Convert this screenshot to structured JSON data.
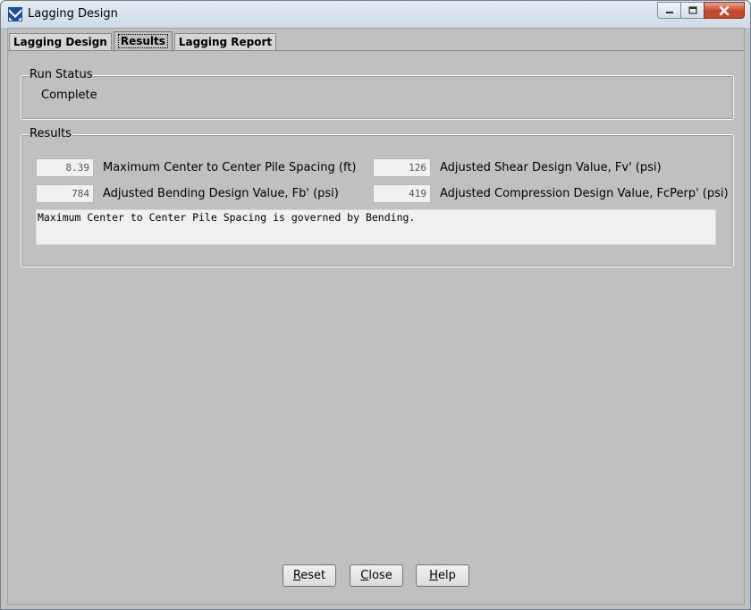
{
  "window": {
    "title": "Lagging Design"
  },
  "tabs": [
    {
      "label": "Lagging Design",
      "active": false
    },
    {
      "label": "Results",
      "active": true
    },
    {
      "label": "Lagging Report",
      "active": false
    }
  ],
  "run_status": {
    "legend": "Run Status",
    "value": "Complete"
  },
  "results": {
    "legend": "Results",
    "fields": [
      {
        "value": "8.39",
        "label": "Maximum Center to Center Pile Spacing (ft)"
      },
      {
        "value": "126",
        "label": "Adjusted Shear Design Value, Fv' (psi)"
      },
      {
        "value": "784",
        "label": "Adjusted Bending Design Value, Fb' (psi)"
      },
      {
        "value": "419",
        "label": "Adjusted Compression Design Value, FcPerp' (psi)"
      }
    ],
    "message": "Maximum Center to Center Pile Spacing is governed by Bending."
  },
  "buttons": {
    "reset": {
      "mnemonic": "R",
      "rest": "eset"
    },
    "close": {
      "mnemonic": "C",
      "rest": "lose"
    },
    "help": {
      "mnemonic": "H",
      "rest": "elp"
    }
  }
}
